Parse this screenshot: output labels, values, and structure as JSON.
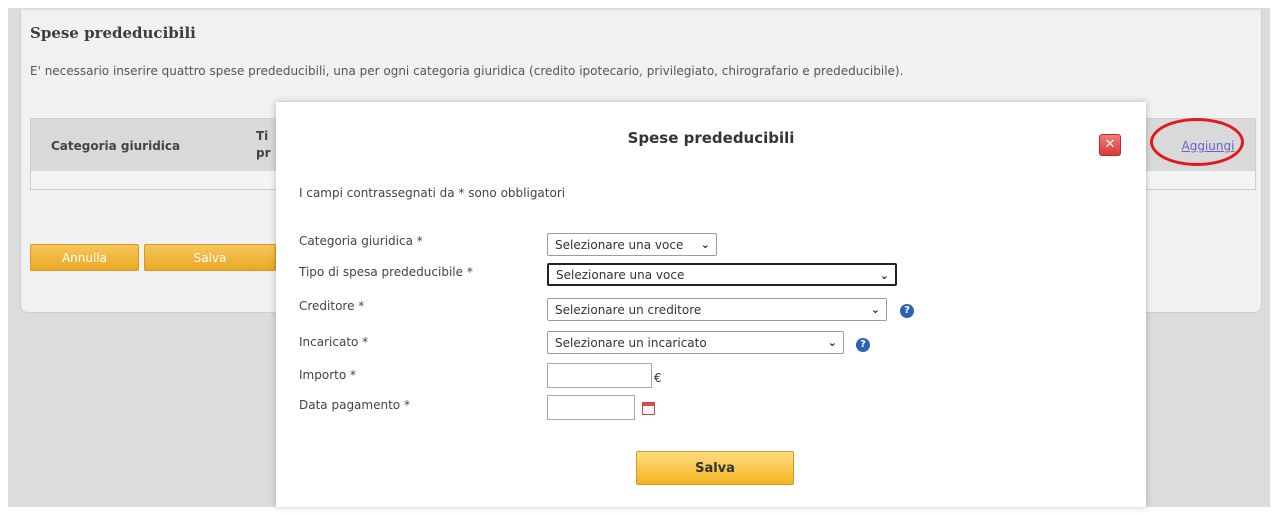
{
  "page": {
    "title": "Spese prededucibili",
    "info": "E' necessario inserire quattro spese prededucibili, una per ogni categoria giuridica (credito ipotecario, privilegiato, chirografario e prededucibile).",
    "table_headers": [
      "Categoria giuridica",
      "Ti pr"
    ],
    "annulla": "Annulla",
    "salva": "Salva",
    "aggiungi": "Aggiungi"
  },
  "modal": {
    "title": "Spese prededucibili",
    "close_icon": "close-icon",
    "mandatory_note": "I campi contrassegnati da * sono obbligatori",
    "fields": {
      "categoria": {
        "label": "Categoria giuridica *",
        "value": "Selezionare una voce"
      },
      "tipo": {
        "label": "Tipo di spesa prededucibile *",
        "value": "Selezionare una voce"
      },
      "creditore": {
        "label": "Creditore *",
        "value": "Selezionare un creditore"
      },
      "incaricato": {
        "label": "Incaricato *",
        "value": "Selezionare un incaricato"
      },
      "importo": {
        "label": "Importo *",
        "value": "",
        "unit": "€"
      },
      "data": {
        "label": "Data pagamento *",
        "value": ""
      }
    },
    "save": "Salva"
  },
  "colors": {
    "accent": "#f4b423",
    "link": "#6a63c9",
    "highlight_ring": "#e0191e",
    "help": "#2c62b5"
  }
}
